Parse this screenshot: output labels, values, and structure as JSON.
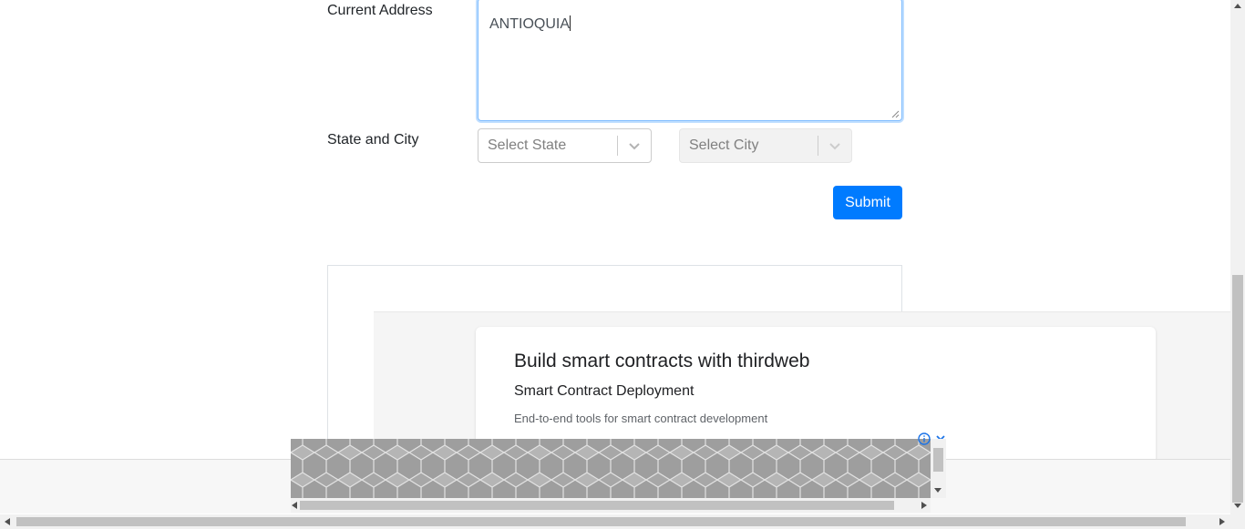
{
  "form": {
    "address_label": "Current Address",
    "address_value": "ANTIOQUIA",
    "state_city_label": "State and City",
    "state_placeholder": "Select State",
    "city_placeholder": "Select City",
    "submit_label": "Submit"
  },
  "ad": {
    "title": "Build smart contracts with thirdweb",
    "subtitle": "Smart Contract Deployment",
    "description": "End-to-end tools for smart contract development"
  },
  "icons": {
    "chevron": "chevron-down-icon",
    "info": "info-icon",
    "close": "close-icon"
  },
  "colors": {
    "primary": "#007bff",
    "focus_border": "#80bdff",
    "banner_gray": "#9e9e9e"
  }
}
